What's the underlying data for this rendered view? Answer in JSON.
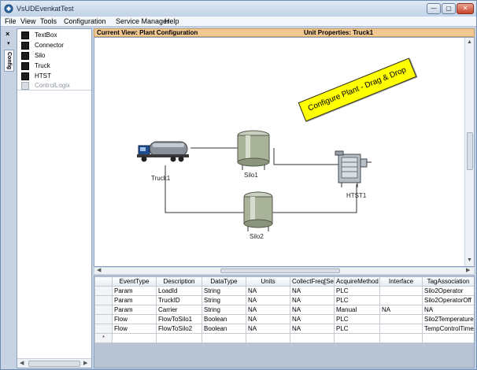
{
  "window": {
    "title": "VsUDEvenkatTest",
    "buttons": {
      "minimize": "—",
      "maximize": "▢",
      "close": "✕"
    }
  },
  "menu": [
    "File",
    "View",
    "Tools",
    "Configuration",
    "Service Manager",
    "Help"
  ],
  "dock": {
    "close": "×",
    "pin": "▾",
    "tab": "Config"
  },
  "toolbox": {
    "items": [
      {
        "label": "TextBox",
        "enabled": true
      },
      {
        "label": "Connector",
        "enabled": true
      },
      {
        "label": "Silo",
        "enabled": true
      },
      {
        "label": "Truck",
        "enabled": true
      },
      {
        "label": "HTST",
        "enabled": true
      },
      {
        "label": "ControlLogix",
        "enabled": false
      }
    ]
  },
  "header": {
    "current_view": "Current View: Plant Configuration",
    "unit_properties": "Unit Properties: Truck1"
  },
  "canvas": {
    "banner": "Configure Plant - Drag & Drop",
    "equipment": {
      "truck": "Truck1",
      "silo1": "Silo1",
      "silo2": "Silo2",
      "htst": "HTST1"
    }
  },
  "grid": {
    "columns": [
      "EventType",
      "Description",
      "DataType",
      "Units",
      "CollectFreq[Sec]",
      "AcquireMethod",
      "Interface",
      "TagAssociation"
    ],
    "rows": [
      [
        "Param",
        "LoadId",
        "String",
        "NA",
        "NA",
        "PLC",
        "",
        "Silo2Operator"
      ],
      [
        "Param",
        "TruckID",
        "String",
        "NA",
        "NA",
        "PLC",
        "",
        "Silo2OperatorOff"
      ],
      [
        "Param",
        "Carrier",
        "String",
        "NA",
        "NA",
        "Manual",
        "NA",
        "NA"
      ],
      [
        "Flow",
        "FlowToSilo1",
        "Boolean",
        "NA",
        "NA",
        "PLC",
        "",
        "Silo2Temperature"
      ],
      [
        "Flow",
        "FlowToSilo2",
        "Boolean",
        "NA",
        "NA",
        "PLC",
        "",
        "TempControlTimer"
      ]
    ],
    "new_row_marker": "*"
  },
  "colors": {
    "header_strip": "#f1c892",
    "banner": "#ffff00",
    "titlebar": "#c2d3e8"
  }
}
